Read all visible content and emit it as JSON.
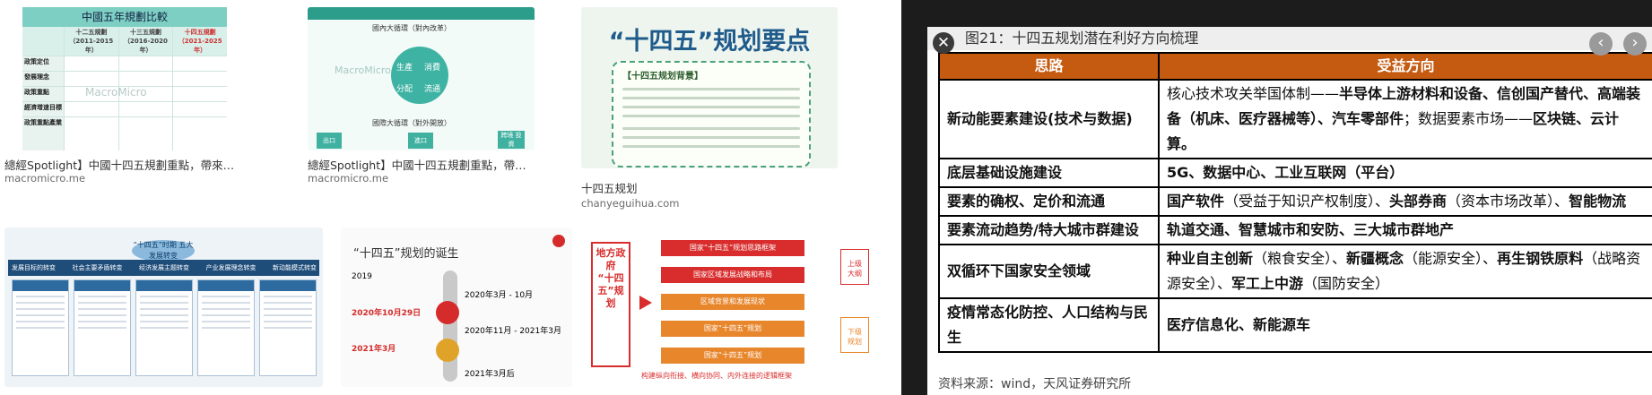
{
  "results": [
    {
      "caption": "總經Spotlight】中國十四五規劃重點，帶來的三大投資機會",
      "source": "macromicro.me",
      "thumb": {
        "header": "中國五年規劃比較",
        "columns": [
          "十二五規劃\n（2011-2015年）",
          "十三五規劃\n（2016-2020年）",
          "十四五規劃\n（2021-2025年）"
        ],
        "rows": [
          "政策定位",
          "發展理念",
          "政策重點",
          "經濟增速目標",
          "政策重點產業"
        ],
        "watermark": "MacroMicro"
      }
    },
    {
      "caption": "總經Spotlight】中國十四五規劃重點，帶來的三大投資機會",
      "source": "macromicro.me",
      "thumb": {
        "top": "國內大循環（對內改革）",
        "ring": [
          "生產",
          "消費",
          "分配",
          "流通"
        ],
        "bottom": "國際大循環（對外開放）",
        "tags": [
          "出口",
          "進口",
          "跨境\n投資"
        ],
        "watermark": "MacroMicro"
      }
    },
    {
      "caption": "十四五规划",
      "source": "chanyeguihua.com",
      "thumb": {
        "title": "“十四五”规划要点",
        "box_label": "【十四五规划背景】"
      }
    },
    {
      "caption": "",
      "source": "",
      "thumb": {
        "dome": "“十四五”时期\n五大发展转变",
        "columns": [
          "发展目标的转变",
          "社会主要矛盾转变",
          "经济发展主题转变",
          "产业发展理念转变",
          "新动能模式转变"
        ]
      }
    },
    {
      "caption": "",
      "source": "",
      "thumb": {
        "title": "“十四五”规划的诞生",
        "timeline": [
          {
            "date": "2019",
            "color": "#333333"
          },
          {
            "date": "2020年10月29日",
            "color": "#d52b2b"
          },
          {
            "date": "2020年3月 - 10月",
            "color": "#333333"
          },
          {
            "date": "2020年11月 - 2021年3月",
            "color": "#333333"
          },
          {
            "date": "2021年3月",
            "color": "#d52b2b"
          },
          {
            "date": "2021年3月后",
            "color": "#333333"
          }
        ]
      }
    },
    {
      "caption": "",
      "source": "",
      "thumb": {
        "left": "地方政府\n“十四五”规划",
        "bars": [
          "国家“十四五”规划思路框架",
          "国家区域发展战略和布局",
          "区域背景和发展现状",
          "国家“十四五”规划",
          "国家“十四五”规划"
        ],
        "right": [
          "上级\n大纲",
          "下级\n规划"
        ],
        "footer": "构建纵向衔接、横向协同、内外连接的逻辑框架"
      }
    }
  ],
  "viewer": {
    "title": "图21：十四五规划潜在利好方向梳理",
    "close_glyph": "✕",
    "prev_glyph": "‹",
    "next_glyph": "›",
    "table": {
      "headers": [
        "思路",
        "受益方向"
      ],
      "rows": [
        {
          "left": "新动能要素建设(技术与数据)",
          "right": [
            {
              "t": "核心技术攻关举国体制——",
              "b": false
            },
            {
              "t": "半导体上游材料和设备、信创国产替代、高端装备（机床、医疗器械等）、汽车零部件",
              "b": true
            },
            {
              "t": "；数据要素市场——",
              "b": false
            },
            {
              "t": "区块链、云计算。",
              "b": true
            }
          ]
        },
        {
          "left": "底层基础设施建设",
          "right": [
            {
              "t": "5G、数据中心、工业互联网（平台）",
              "b": true
            }
          ]
        },
        {
          "left": "要素的确权、定价和流通",
          "right": [
            {
              "t": "国产软件",
              "b": true
            },
            {
              "t": "（受益于知识产权制度）、",
              "b": false
            },
            {
              "t": "头部券商",
              "b": true
            },
            {
              "t": "（资本市场改革）、",
              "b": false
            },
            {
              "t": "智能物流",
              "b": true
            }
          ]
        },
        {
          "left": "要素流动趋势/特大城市群建设",
          "right": [
            {
              "t": "轨道交通、智慧城市和安防、三大城市群地产",
              "b": true
            }
          ]
        },
        {
          "left": "双循环下国家安全领域",
          "right": [
            {
              "t": "种业自主创新",
              "b": true
            },
            {
              "t": "（粮食安全）、",
              "b": false
            },
            {
              "t": "新疆概念",
              "b": true
            },
            {
              "t": "（能源安全）、",
              "b": false
            },
            {
              "t": "再生钢铁原料",
              "b": true
            },
            {
              "t": "（战略资源安全）、",
              "b": false
            },
            {
              "t": "军工上中游",
              "b": true
            },
            {
              "t": "（国防安全）",
              "b": false
            }
          ]
        },
        {
          "left": "疫情常态化防控、人口结构与民生",
          "right": [
            {
              "t": "医疗信息化、新能源车",
              "b": true
            }
          ]
        }
      ]
    },
    "source": "资料来源：wind，天风证券研究所"
  }
}
